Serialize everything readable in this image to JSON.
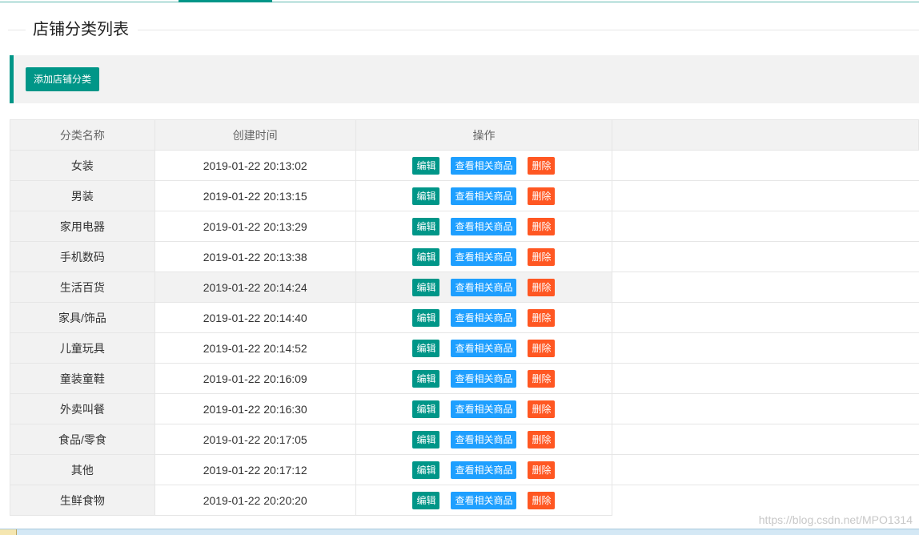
{
  "page": {
    "title": "店铺分类列表"
  },
  "toolbar": {
    "add_label": "添加店铺分类"
  },
  "table": {
    "headers": [
      "分类名称",
      "创建时间",
      "操作"
    ],
    "actions": {
      "edit": "编辑",
      "view": "查看相关商品",
      "delete": "删除"
    },
    "rows": [
      {
        "name": "女装",
        "created": "2019-01-22 20:13:02"
      },
      {
        "name": "男装",
        "created": "2019-01-22 20:13:15"
      },
      {
        "name": "家用电器",
        "created": "2019-01-22 20:13:29"
      },
      {
        "name": "手机数码",
        "created": "2019-01-22 20:13:38"
      },
      {
        "name": "生活百货",
        "created": "2019-01-22 20:14:24"
      },
      {
        "name": "家具/饰品",
        "created": "2019-01-22 20:14:40"
      },
      {
        "name": "儿童玩具",
        "created": "2019-01-22 20:14:52"
      },
      {
        "name": "童装童鞋",
        "created": "2019-01-22 20:16:09"
      },
      {
        "name": "外卖叫餐",
        "created": "2019-01-22 20:16:30"
      },
      {
        "name": "食品/零食",
        "created": "2019-01-22 20:17:05"
      },
      {
        "name": "其他",
        "created": "2019-01-22 20:17:12"
      },
      {
        "name": "生鲜食物",
        "created": "2019-01-22 20:20:20"
      }
    ],
    "hover_row": 4
  },
  "watermark": "https://blog.csdn.net/MPO1314",
  "colors": {
    "primary": "#009688",
    "normal": "#1E9FFF",
    "danger": "#FF5722"
  }
}
